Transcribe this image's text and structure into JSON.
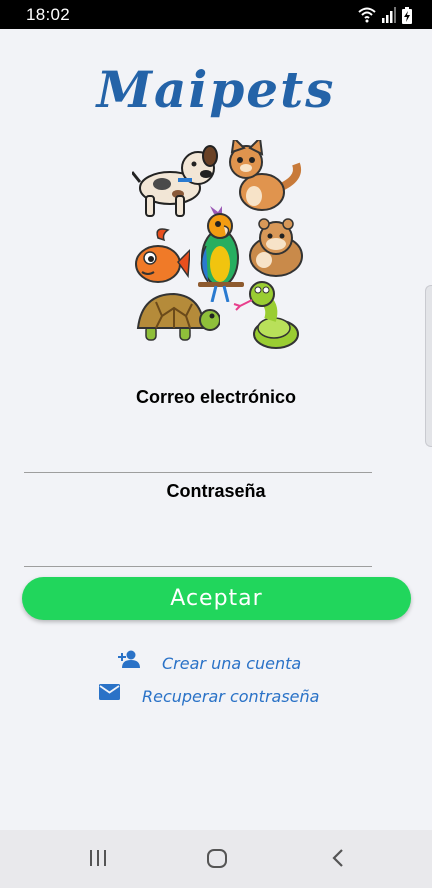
{
  "status_bar": {
    "time": "18:02",
    "icons": [
      "wifi-icon",
      "signal-icon",
      "battery-charging-icon"
    ]
  },
  "app": {
    "logo": "Maipets",
    "illustration": "pets-illustration"
  },
  "form": {
    "email_label": "Correo electrónico",
    "email_value": "",
    "password_label": "Contraseña",
    "password_value": ""
  },
  "actions": {
    "accept_label": "Aceptar",
    "create_account_label": "Crear una cuenta",
    "recover_password_label": "Recuperar contraseña"
  },
  "nav_bar": {
    "icons": [
      "recent-apps-icon",
      "home-icon",
      "back-icon"
    ]
  },
  "colors": {
    "brand": "#2463a8",
    "accept_button": "#21d65c",
    "link": "#2a72c7"
  }
}
